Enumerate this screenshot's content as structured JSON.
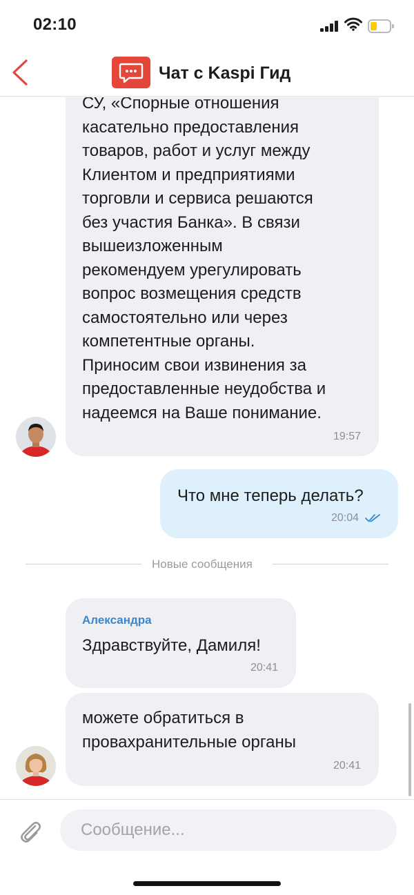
{
  "status_bar": {
    "time": "02:10",
    "icons": [
      "cellular-signal-icon",
      "wifi-icon",
      "battery-low-icon"
    ],
    "battery_color": "#ffcc00"
  },
  "header": {
    "title": "Чат с Kaspi Гид",
    "back_icon": "chevron-left-icon",
    "chat_icon": "chat-bubble-icon",
    "brand_color": "#e4473a"
  },
  "messages": [
    {
      "direction": "incoming",
      "lines": [
        "СУ, «Спорные отношения",
        "касательно предоставления",
        "товаров, работ и услуг между",
        "Клиентом и предприятиями",
        "торговли и сервиса решаются",
        "без участия Банка». В связи",
        "вышеизложенным",
        "рекомендуем урегулировать",
        "вопрос возмещения средств",
        "самостоятельно или через",
        "компетентные органы.",
        "Приносим свои извинения за",
        "предоставленные неудобства и",
        "надеемся на Ваше понимание."
      ],
      "time": "19:57"
    },
    {
      "direction": "outgoing",
      "text": "Что мне теперь делать?",
      "time": "20:04",
      "status_icon": "double-check-icon"
    },
    {
      "direction": "incoming",
      "sender": "Александра",
      "text": "Здравствуйте, Дамиля!",
      "time": "20:41"
    },
    {
      "direction": "incoming",
      "lines": [
        "можете обратиться в",
        "провахранительные органы"
      ],
      "time": "20:41"
    }
  ],
  "divider": {
    "label": "Новые сообщения"
  },
  "composer": {
    "placeholder": "Сообщение...",
    "attach_icon": "paperclip-icon"
  },
  "colors": {
    "incoming_bubble": "#eff0f4",
    "outgoing_bubble": "#def0fb",
    "sender_name": "#3c87c8",
    "read_check": "#3c87c8"
  }
}
